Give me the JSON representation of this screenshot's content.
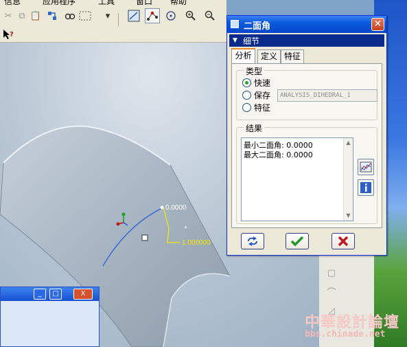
{
  "menubar": {
    "items": [
      "信息",
      "应用程序",
      "工具",
      "窗口",
      "帮助"
    ]
  },
  "dialog": {
    "title": "二面角",
    "close_glyph": "✕",
    "section_label": "细节",
    "tabs": [
      {
        "label": "分析",
        "selected": true
      },
      {
        "label": "定义",
        "selected": false
      },
      {
        "label": "特征",
        "selected": false
      }
    ],
    "type_group": {
      "label": "类型",
      "options": [
        {
          "label": "快速",
          "checked": true
        },
        {
          "label": "保存",
          "checked": false
        },
        {
          "label": "特征",
          "checked": false
        }
      ],
      "name_value": "ANALYSIS_DIHEDRAL_1"
    },
    "result_group": {
      "label": "结果",
      "lines": [
        "最小二面角: 0.0000",
        "最大二面角: 0.0000"
      ]
    },
    "buttons": {
      "repeat_icon": "repeat-icon",
      "ok_icon": "checkmark-icon",
      "cancel_icon": "cancel-x-icon"
    }
  },
  "viewport": {
    "annotation_angle": "0.0000",
    "annotation_value": "1.000000"
  },
  "mini_window": {
    "min_glyph": "_",
    "max_glyph": "□",
    "close_glyph": "X"
  },
  "watermark": {
    "title": "中華設計論壇",
    "url": "bbs.chinade.net"
  },
  "colors": {
    "dialog_title": "#0a5ae0",
    "section_bar": "#0a2a8c",
    "ok_green": "#1f9a2a",
    "cancel_red": "#c4161c",
    "surface": "#b7c3d0"
  }
}
